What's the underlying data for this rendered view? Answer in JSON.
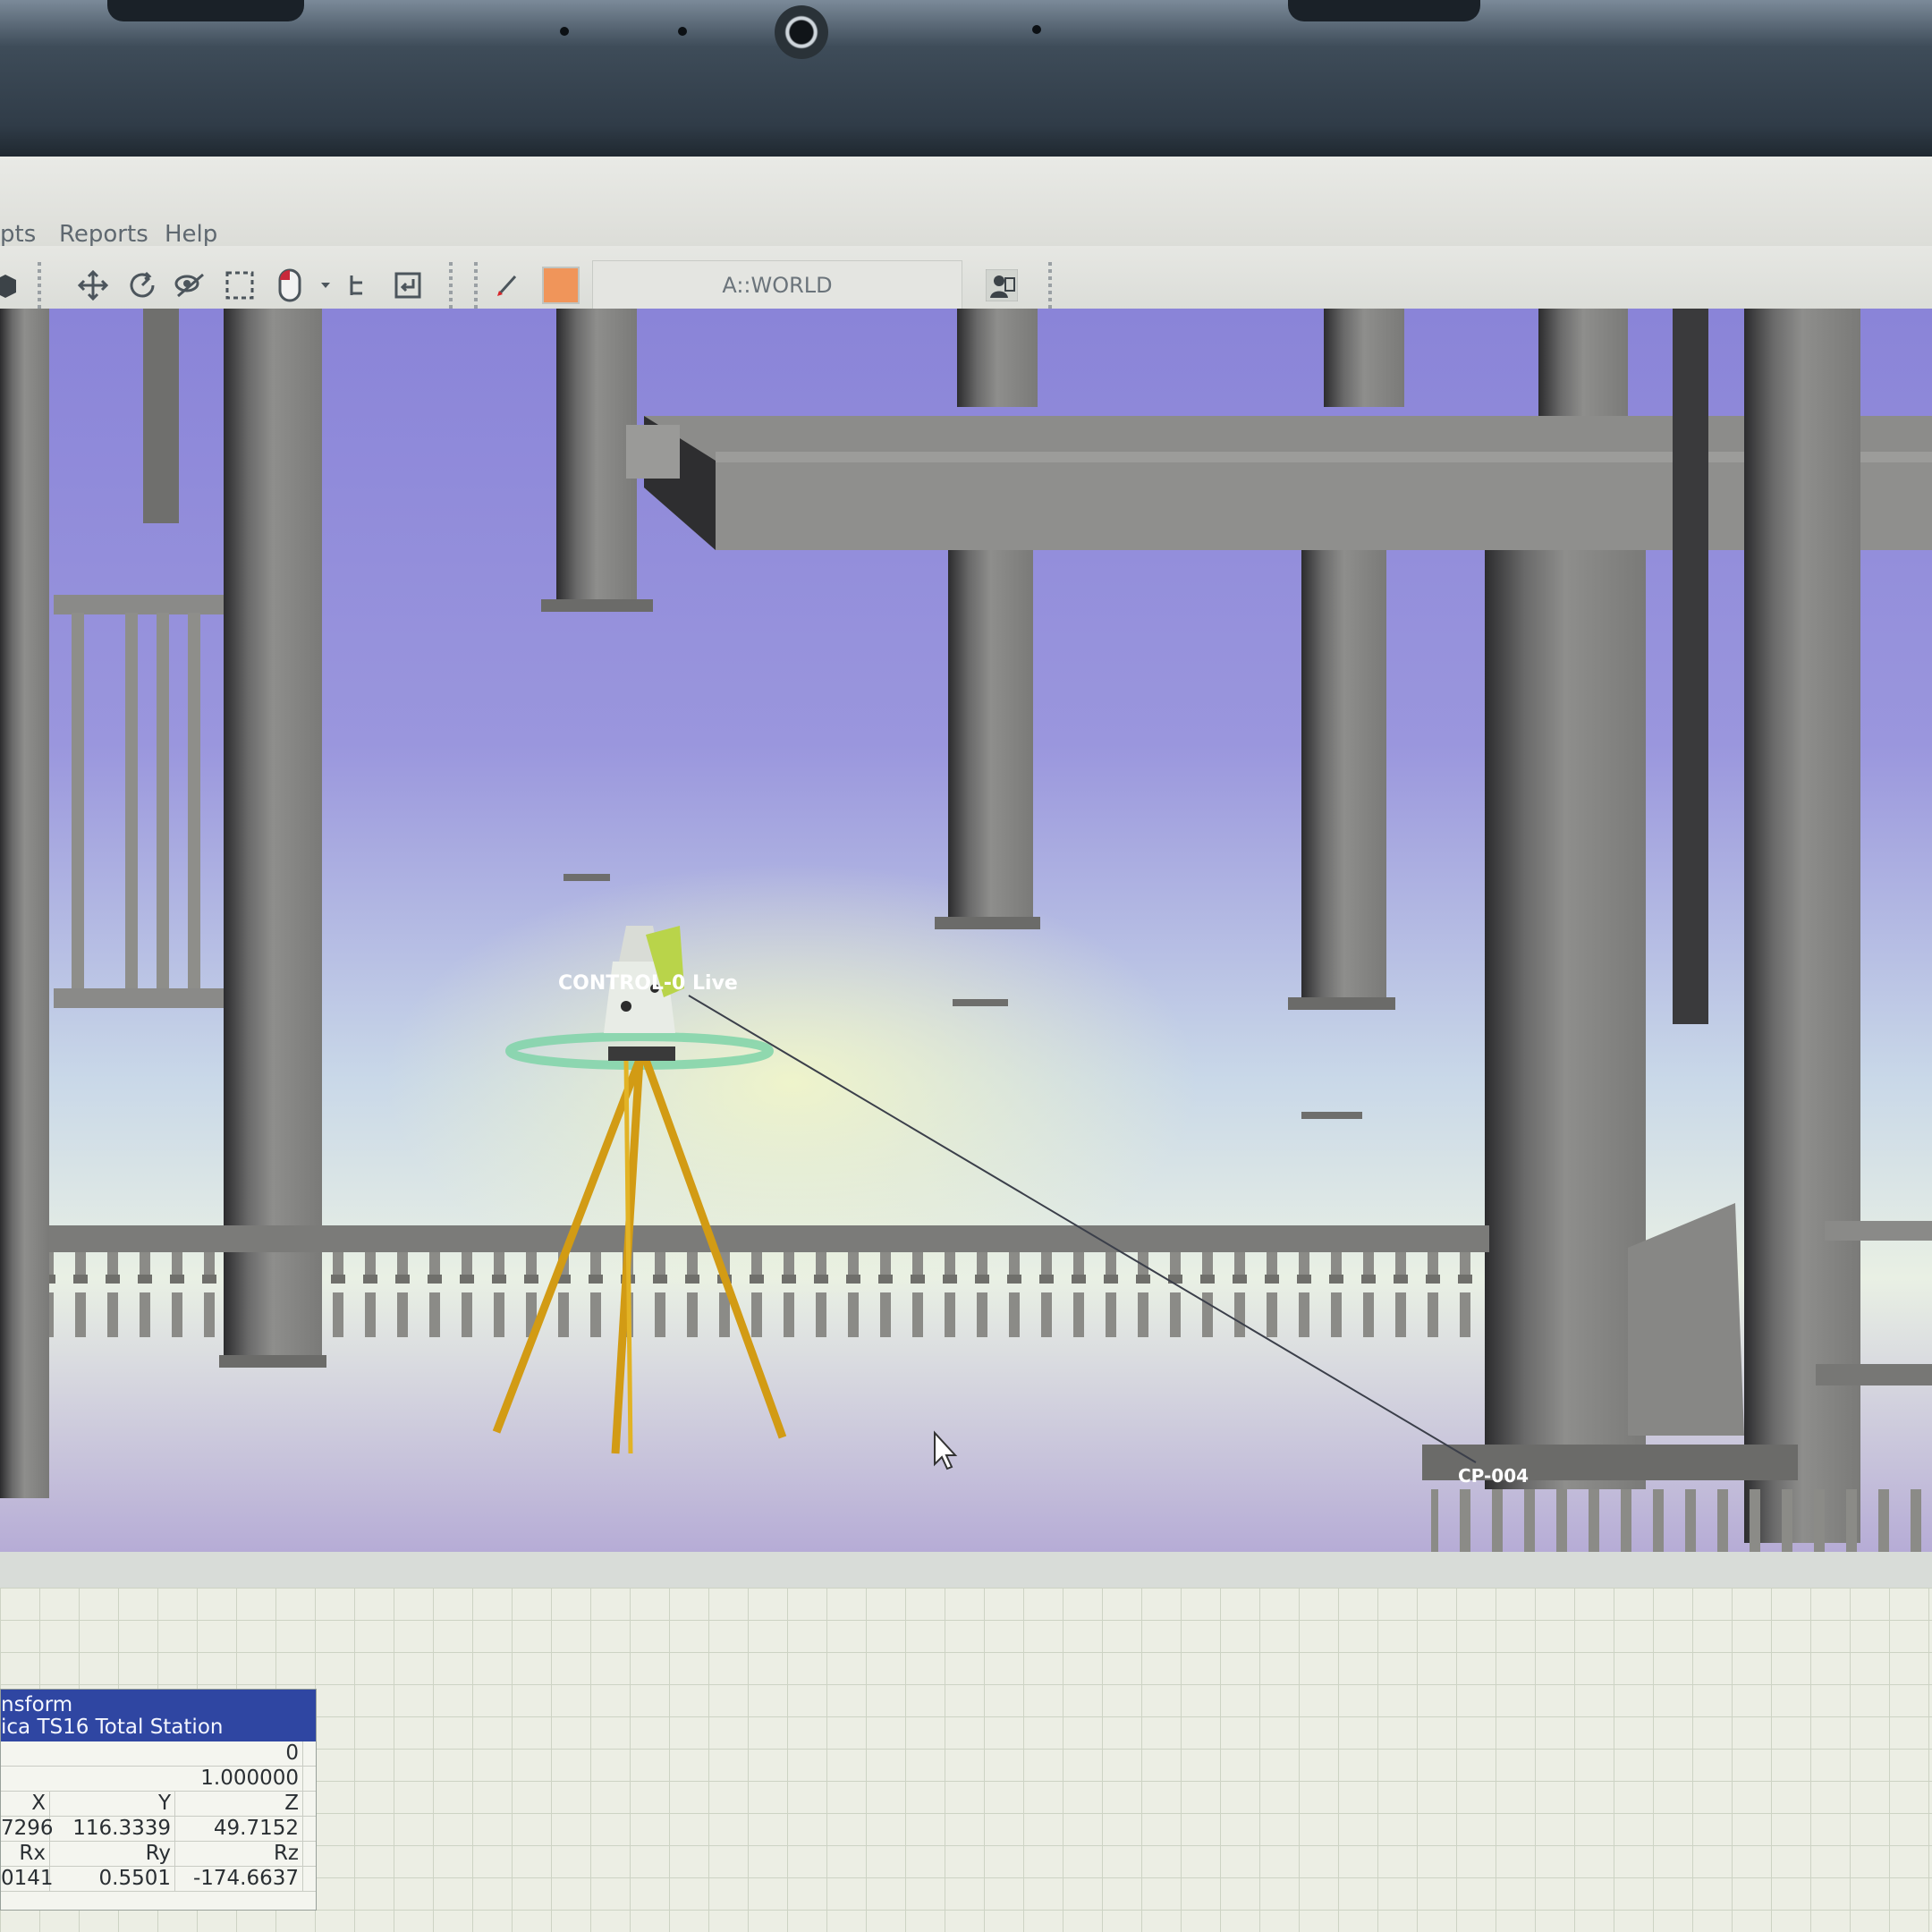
{
  "menu": {
    "items_partial": "pts",
    "reports": "Reports",
    "help": "Help"
  },
  "toolbar": {
    "frame_name": "A::WORLD",
    "icons": [
      "cube-icon",
      "move-icon",
      "rotate-icon",
      "hide-icon",
      "select-box-icon",
      "mouse-icon",
      "tree-icon",
      "return-icon",
      "pencil-icon",
      "color-swatch",
      "user-icon"
    ],
    "accent_color": "#f0955a"
  },
  "viewport": {
    "instrument_label": "CONTROL-0 Live",
    "point_label": "CP-004"
  },
  "transform_panel": {
    "title_line1": "nsform",
    "title_line2": "ica TS16 Total Station",
    "row1_value": "0",
    "row2_value": "1.000000",
    "headers_pos": [
      "X",
      "Y",
      "Z"
    ],
    "values_pos": [
      "7296",
      "116.3339",
      "49.7152"
    ],
    "headers_rot": [
      "Rx",
      "Ry",
      "Rz"
    ],
    "values_rot": [
      "0141",
      "0.5501",
      "-174.6637"
    ]
  }
}
